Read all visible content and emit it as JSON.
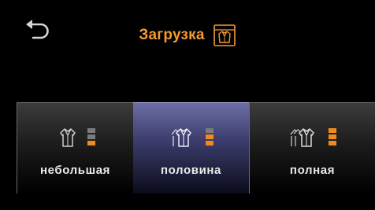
{
  "header": {
    "title": "Загрузка",
    "back_icon": "back-arrow-icon",
    "title_icon": "laundry-load-icon",
    "accent_color": "#f39a31"
  },
  "options": [
    {
      "label": "небольшая",
      "icon": "shirt-small-load-icon",
      "level": 1,
      "selected": false
    },
    {
      "label": "половина",
      "icon": "shirt-half-load-icon",
      "level": 2,
      "selected": true
    },
    {
      "label": "полная",
      "icon": "shirt-full-load-icon",
      "level": 3,
      "selected": false
    }
  ],
  "colors": {
    "level_on": "#f08a1e",
    "level_off": "#7b7b7b",
    "selected_bg": "#3d3e6e"
  }
}
